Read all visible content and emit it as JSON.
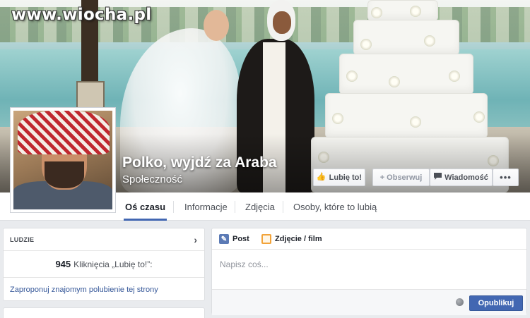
{
  "watermark": "www.wiocha.pl",
  "page": {
    "name": "Polko, wyjdź za Araba",
    "category": "Społeczność"
  },
  "cover_actions": {
    "like": "Lubię to!",
    "follow": "+ Obserwuj",
    "message": "Wiadomość",
    "more": "•••"
  },
  "tabs": [
    {
      "label": "Oś czasu",
      "active": true
    },
    {
      "label": "Informacje",
      "active": false
    },
    {
      "label": "Zdjęcia",
      "active": false
    },
    {
      "label": "Osoby, które to lubią",
      "active": false
    }
  ],
  "people_card": {
    "header": "LUDZIE",
    "likes_count": "945",
    "likes_label": "Kliknięcia „Lubię to!”:",
    "suggest_link": "Zaproponuj znajomym polubienie tej strony"
  },
  "composer": {
    "tab_post": "Post",
    "tab_photo": "Zdjęcie / film",
    "placeholder": "Napisz coś...",
    "publish": "Opublikuj"
  },
  "colors": {
    "accent": "#4267b2",
    "link": "#365899",
    "background": "#e9ebee"
  },
  "icons": [
    "thumbs-up-icon",
    "speech-bubble-icon",
    "chevron-right-icon",
    "pencil-icon",
    "photo-icon",
    "globe-icon"
  ]
}
